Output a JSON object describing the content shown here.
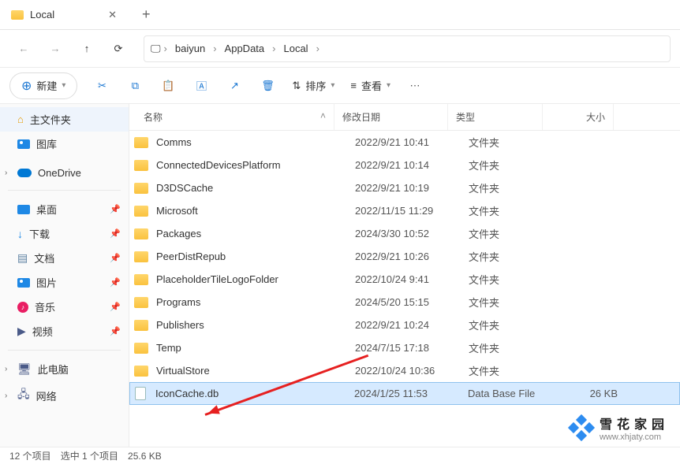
{
  "tab": {
    "title": "Local"
  },
  "breadcrumb": [
    "baiyun",
    "AppData",
    "Local"
  ],
  "toolbar": {
    "new_label": "新建",
    "sort_label": "排序",
    "view_label": "查看"
  },
  "sidebar": {
    "home": "主文件夹",
    "gallery": "图库",
    "onedrive": "OneDrive",
    "desktop": "桌面",
    "downloads": "下载",
    "documents": "文档",
    "pictures": "图片",
    "music": "音乐",
    "videos": "视频",
    "thispc": "此电脑",
    "network": "网络"
  },
  "columns": {
    "name": "名称",
    "date": "修改日期",
    "type": "类型",
    "size": "大小"
  },
  "type_folder": "文件夹",
  "files": [
    {
      "name": "Comms",
      "date": "2022/9/21 10:41",
      "type": "文件夹",
      "size": "",
      "kind": "folder"
    },
    {
      "name": "ConnectedDevicesPlatform",
      "date": "2022/9/21 10:14",
      "type": "文件夹",
      "size": "",
      "kind": "folder"
    },
    {
      "name": "D3DSCache",
      "date": "2022/9/21 10:19",
      "type": "文件夹",
      "size": "",
      "kind": "folder"
    },
    {
      "name": "Microsoft",
      "date": "2022/11/15 11:29",
      "type": "文件夹",
      "size": "",
      "kind": "folder"
    },
    {
      "name": "Packages",
      "date": "2024/3/30 10:52",
      "type": "文件夹",
      "size": "",
      "kind": "folder"
    },
    {
      "name": "PeerDistRepub",
      "date": "2022/9/21 10:26",
      "type": "文件夹",
      "size": "",
      "kind": "folder"
    },
    {
      "name": "PlaceholderTileLogoFolder",
      "date": "2022/10/24 9:41",
      "type": "文件夹",
      "size": "",
      "kind": "folder"
    },
    {
      "name": "Programs",
      "date": "2024/5/20 15:15",
      "type": "文件夹",
      "size": "",
      "kind": "folder"
    },
    {
      "name": "Publishers",
      "date": "2022/9/21 10:24",
      "type": "文件夹",
      "size": "",
      "kind": "folder"
    },
    {
      "name": "Temp",
      "date": "2024/7/15 17:18",
      "type": "文件夹",
      "size": "",
      "kind": "folder"
    },
    {
      "name": "VirtualStore",
      "date": "2022/10/24 10:36",
      "type": "文件夹",
      "size": "",
      "kind": "folder"
    },
    {
      "name": "IconCache.db",
      "date": "2024/1/25 11:53",
      "type": "Data Base File",
      "size": "26 KB",
      "kind": "file",
      "selected": true
    }
  ],
  "status": {
    "count": "12 个项目",
    "selected": "选中 1 个项目",
    "size": "25.6 KB"
  },
  "watermark": {
    "title": "雪花家园",
    "url": "www.xhjaty.com"
  }
}
